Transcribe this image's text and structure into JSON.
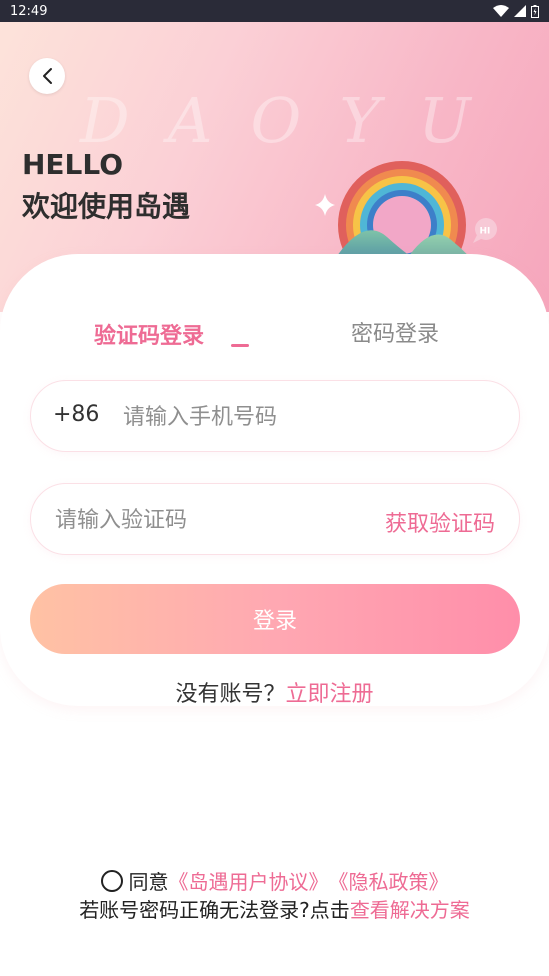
{
  "status_bar": {
    "time": "12:49"
  },
  "header": {
    "watermark": "DAOYU",
    "greeting": "HELLO",
    "welcome": "欢迎使用岛遇",
    "badge": "HI"
  },
  "tabs": {
    "code_login": "验证码登录",
    "password_login": "密码登录",
    "active": "code_login"
  },
  "phone": {
    "prefix": "+86",
    "placeholder": "请输入手机号码",
    "value": ""
  },
  "code": {
    "placeholder": "请输入验证码",
    "value": "",
    "get_code": "获取验证码"
  },
  "login_button": "登录",
  "register": {
    "question": "没有账号？",
    "link": "立即注册"
  },
  "agreement": {
    "agree": "同意",
    "user_agreement": "《岛遇用户协议》",
    "privacy_policy": "《隐私政策》",
    "checked": false
  },
  "help": {
    "text": "若账号密码正确无法登录?点击",
    "link": "查看解决方案"
  },
  "colors": {
    "accent": "#ee6b94",
    "button_start": "#ffc2a4",
    "button_end": "#ff8eaa"
  },
  "icons": [
    "back-arrow-icon",
    "wifi-icon",
    "signal-icon",
    "battery-icon",
    "sparkle-icon",
    "hi-bubble-icon"
  ]
}
